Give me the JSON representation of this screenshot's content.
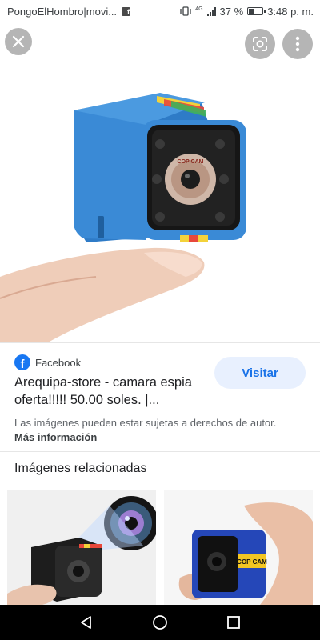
{
  "status_bar": {
    "app_text": "PongoElHombro|movi...",
    "notification_icon": "facebook-icon",
    "network_text": "4G",
    "battery_text": "37 %",
    "battery_level": 0.37,
    "time": "3:48 p. m."
  },
  "viewer": {
    "close_icon": "close-icon",
    "lens_icon": "google-lens-icon",
    "more_icon": "more-vert-icon",
    "camera_label": "COP CAM"
  },
  "result": {
    "source_name": "Facebook",
    "source_icon": "facebook-logo",
    "title": "Arequipa-store - camara espia oferta!!!!! 50.00 soles. |...",
    "visit_label": "Visitar",
    "rights_text": "Las imágenes pueden estar sujetas a derechos de autor.",
    "more_info_label": "Más información"
  },
  "related": {
    "heading": "Imágenes relacionadas",
    "thumbnails": [
      {
        "icon": "black-mini-camera-image"
      },
      {
        "icon": "blue-cop-cam-image",
        "label": "COP CAM"
      }
    ]
  },
  "nav": {
    "back_icon": "back-triangle-icon",
    "home_icon": "home-circle-icon",
    "recents_icon": "recents-square-icon"
  },
  "colors": {
    "accent": "#1a73e8",
    "visit_bg": "#e8f0fe",
    "camera_blue": "#3a8ad6",
    "facebook_blue": "#1877f2"
  }
}
